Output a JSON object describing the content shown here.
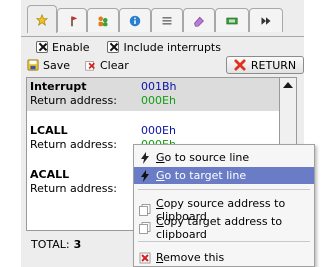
{
  "tabs": [
    {
      "icon": "star-icon",
      "active": true
    },
    {
      "icon": "pin-flag-icon",
      "active": false
    },
    {
      "icon": "people-icon",
      "active": false
    },
    {
      "icon": "info-icon",
      "active": false
    },
    {
      "icon": "list-icon",
      "active": false
    },
    {
      "icon": "eraser-icon",
      "active": false
    },
    {
      "icon": "chip-icon",
      "active": false
    },
    {
      "icon": "fast-forward-icon",
      "active": false
    }
  ],
  "options": {
    "enable_label": "Enable",
    "include_interrupts_label": "Include interrupts"
  },
  "toolbar": {
    "save_label": "Save",
    "clear_label": "Clear",
    "return_label": "RETURN"
  },
  "entries": [
    {
      "type": "Interrupt",
      "address": "001Bh",
      "return_label": "Return address:",
      "return_address": "000Eh"
    },
    {
      "type": "LCALL",
      "address": "000Eh",
      "return_label": "Return address:",
      "return_address": "000Eh"
    },
    {
      "type": "ACALL",
      "address": "",
      "return_label": "Return address:",
      "return_address": ""
    }
  ],
  "total": {
    "label": "TOTAL:",
    "value": "3"
  },
  "context_menu": {
    "go_source_pre": "",
    "go_source_u": "G",
    "go_source_post": "o to source line",
    "go_target_pre": "",
    "go_target_u": "G",
    "go_target_post": "o to target line",
    "copy_source_pre": "",
    "copy_source_u": "C",
    "copy_source_post": "opy source address to clipboard",
    "copy_target_pre": "",
    "copy_target_u": "C",
    "copy_target_post": "opy target address to clipboard",
    "remove_pre": "",
    "remove_u": "R",
    "remove_post": "emove this"
  },
  "colors": {
    "highlight": "#6a7cc6",
    "address_blue": "#0b12a8",
    "address_green": "#119e11",
    "selected_row": "#dcdcdc"
  }
}
